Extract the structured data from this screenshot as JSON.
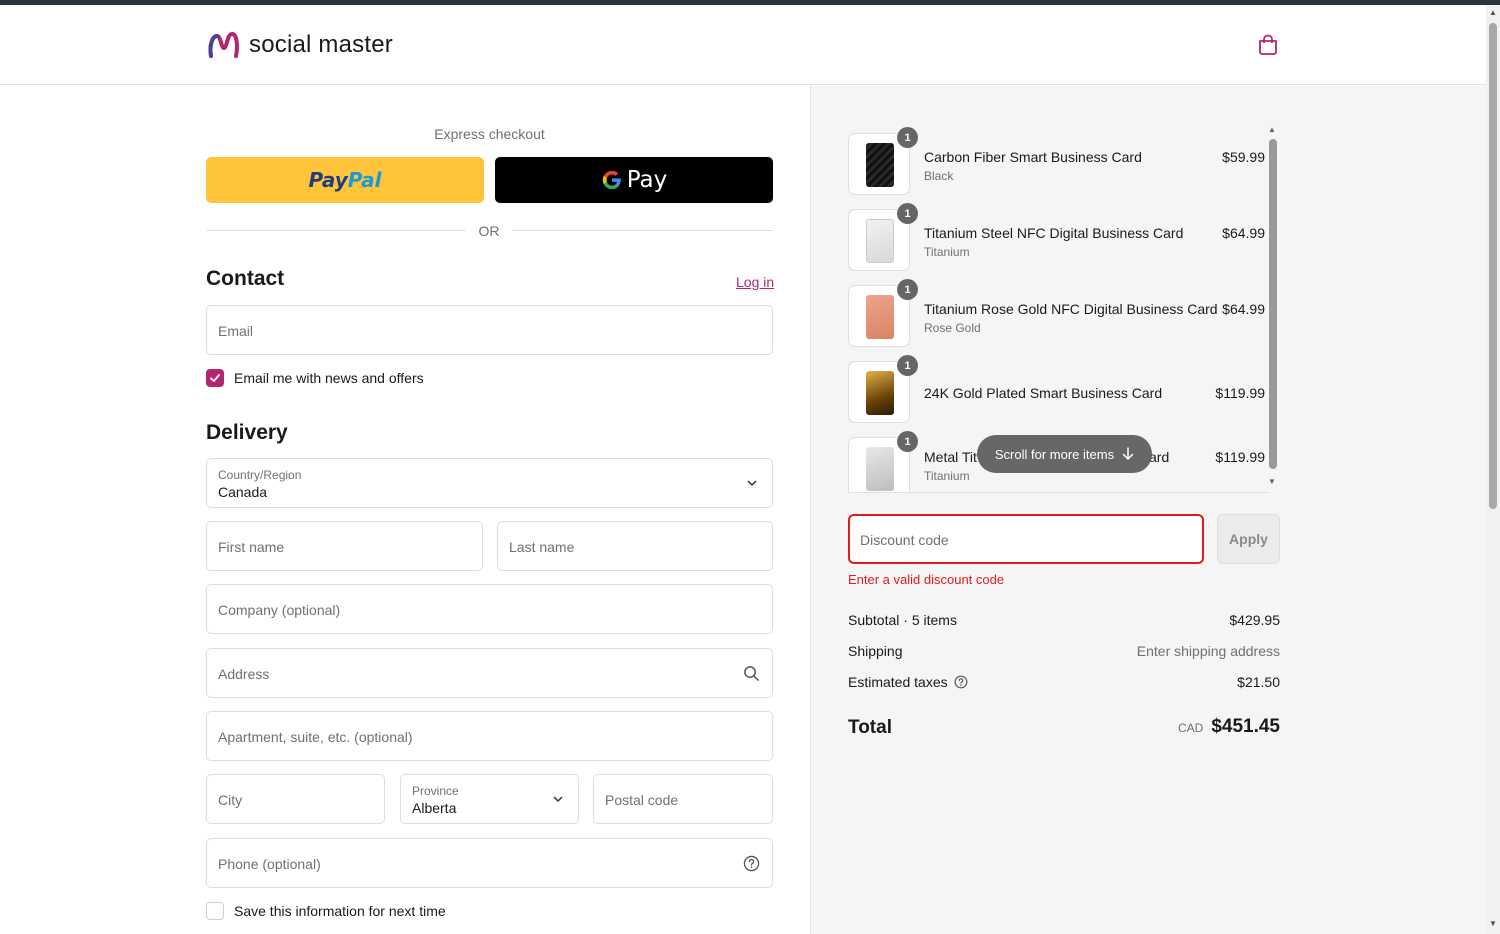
{
  "brand": {
    "name": "social master",
    "accent": "#b3256e"
  },
  "express": {
    "label": "Express checkout",
    "paypal_label": "Pay",
    "paypal_label2": "Pal",
    "gpay_label": "Pay",
    "or_label": "OR"
  },
  "contact": {
    "title": "Contact",
    "login_link": "Log in",
    "email_placeholder": "Email",
    "newsletter_label": "Email me with news and offers",
    "newsletter_checked": true
  },
  "delivery": {
    "title": "Delivery",
    "country_label": "Country/Region",
    "country_value": "Canada",
    "first_name_placeholder": "First name",
    "last_name_placeholder": "Last name",
    "company_placeholder": "Company (optional)",
    "address_placeholder": "Address",
    "apartment_placeholder": "Apartment, suite, etc. (optional)",
    "city_placeholder": "City",
    "province_label": "Province",
    "province_value": "Alberta",
    "postal_placeholder": "Postal code",
    "phone_placeholder": "Phone (optional)",
    "save_info_label": "Save this information for next time",
    "save_info_checked": false
  },
  "order": {
    "items": [
      {
        "qty": "1",
        "name": "Carbon Fiber Smart Business Card",
        "variant": "Black",
        "price": "$59.99",
        "color": "#1a1a1a"
      },
      {
        "qty": "1",
        "name": "Titanium Steel NFC Digital Business Card",
        "variant": "Titanium",
        "price": "$64.99",
        "color": "#e4e4e4"
      },
      {
        "qty": "1",
        "name": "Titanium Rose Gold NFC Digital Business Card",
        "variant": "Rose Gold",
        "price": "$64.99",
        "color": "#e0957a"
      },
      {
        "qty": "1",
        "name": "24K Gold Plated Smart Business Card",
        "variant": "",
        "price": "$119.99",
        "color": "#b07a18"
      },
      {
        "qty": "1",
        "name_visible_start": "Metal Tit",
        "name_visible_end": "ard",
        "variant": "Titanium",
        "price": "$119.99",
        "color": "#cfcfcf"
      }
    ],
    "scroll_hint": "Scroll for more items",
    "discount_placeholder": "Discount code",
    "apply_label": "Apply",
    "discount_error": "Enter a valid discount code",
    "error_color": "#dd1d1d",
    "subtotal_label": "Subtotal · 5 items",
    "subtotal_value": "$429.95",
    "shipping_label": "Shipping",
    "shipping_value": "Enter shipping address",
    "taxes_label": "Estimated taxes",
    "taxes_value": "$21.50",
    "total_label": "Total",
    "total_currency": "CAD",
    "total_value": "$451.45"
  }
}
